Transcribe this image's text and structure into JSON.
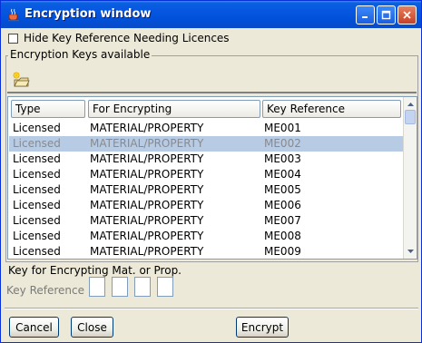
{
  "window": {
    "title": "Encryption window",
    "icons": {
      "app": "java-cup-icon",
      "minimize": "minimize-icon",
      "maximize": "maximize-icon",
      "close": "close-icon"
    }
  },
  "options": {
    "hide_key_reference_label": "Hide Key Reference Needing Licences",
    "hide_key_reference_checked": false
  },
  "keys_group": {
    "title": "Encryption Keys available",
    "toolbar_icon": "open-folder-icon",
    "columns": [
      "Type",
      "For Encrypting",
      "Key Reference"
    ],
    "rows": [
      {
        "type": "Licensed",
        "for": "MATERIAL/PROPERTY",
        "ref": "ME001",
        "selected": false
      },
      {
        "type": "Licensed",
        "for": "MATERIAL/PROPERTY",
        "ref": "ME002",
        "selected": true
      },
      {
        "type": "Licensed",
        "for": "MATERIAL/PROPERTY",
        "ref": "ME003",
        "selected": false
      },
      {
        "type": "Licensed",
        "for": "MATERIAL/PROPERTY",
        "ref": "ME004",
        "selected": false
      },
      {
        "type": "Licensed",
        "for": "MATERIAL/PROPERTY",
        "ref": "ME005",
        "selected": false
      },
      {
        "type": "Licensed",
        "for": "MATERIAL/PROPERTY",
        "ref": "ME006",
        "selected": false
      },
      {
        "type": "Licensed",
        "for": "MATERIAL/PROPERTY",
        "ref": "ME007",
        "selected": false
      },
      {
        "type": "Licensed",
        "for": "MATERIAL/PROPERTY",
        "ref": "ME008",
        "selected": false
      },
      {
        "type": "Licensed",
        "for": "MATERIAL/PROPERTY",
        "ref": "ME009",
        "selected": false
      }
    ]
  },
  "key_section": {
    "title": "Key for Encrypting Mat. or Prop.",
    "label": "Key Reference",
    "boxes": [
      "",
      "",
      "",
      ""
    ]
  },
  "buttons": {
    "cancel": "Cancel",
    "close": "Close",
    "encrypt": "Encrypt"
  },
  "colors": {
    "titlebar": "#0656e0",
    "selected_row": "#b7cbe4",
    "window_bg": "#ece9d8"
  }
}
